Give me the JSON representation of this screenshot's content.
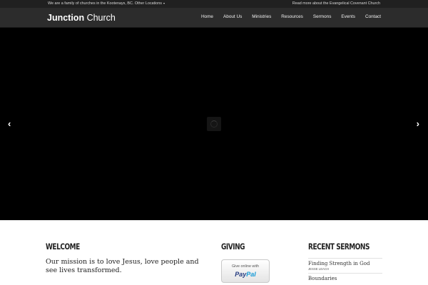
{
  "topbar": {
    "intro": "We are a family of churches in the Kootenays, BC.",
    "locations_label": "Other Locations",
    "right_link": "Read more about the Evangelical Covenant Church"
  },
  "header": {
    "logo_bold": "Junction",
    "logo_light": "Church",
    "nav": [
      "Home",
      "About Us",
      "Ministries",
      "Resources",
      "Sermons",
      "Events",
      "Contact"
    ]
  },
  "hero": {
    "prev_glyph": "‹",
    "next_glyph": "›",
    "background": "#000000"
  },
  "welcome": {
    "title": "WELCOME",
    "text": "Our mission is to love Jesus, love people and see lives transformed."
  },
  "giving": {
    "title": "GIVING",
    "button_caption": "Give online with",
    "brand_pay": "Pay",
    "brand_pal": "Pal"
  },
  "sermons": {
    "title": "RECENT SERMONS",
    "items": [
      {
        "title": "Finding Strength in God",
        "speaker": "JESSE LEACH"
      },
      {
        "title": "Boundaries",
        "speaker": ""
      }
    ]
  },
  "colors": {
    "topbar": "#202020",
    "header": "#2c2c2c",
    "paypal_dark": "#253b80",
    "paypal_light": "#179bd7"
  }
}
